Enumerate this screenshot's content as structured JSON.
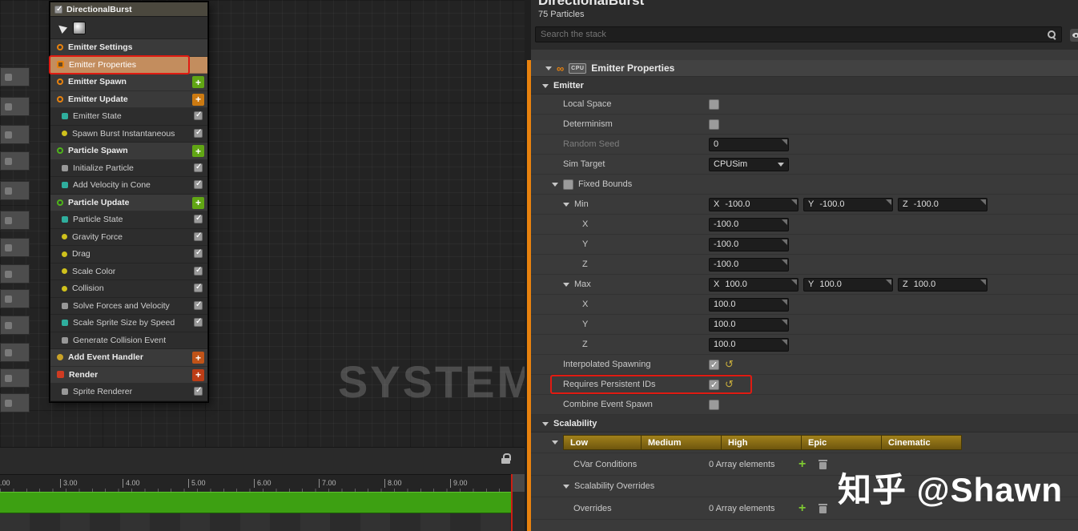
{
  "colors": {
    "accent_orange": "#E8820E",
    "annotation_red": "#E01B12",
    "selection_tan": "#C38D5E",
    "timeline_green": "#3DA012",
    "scalability_gold": "#8A6C10"
  },
  "watermarks": {
    "system": "SYSTEM",
    "zhihu": "知乎 @Shawn"
  },
  "node": {
    "title": "DirectionalBurst",
    "rows": [
      {
        "label": "Emitter Settings"
      },
      {
        "label": "Emitter Properties"
      },
      {
        "label": "Emitter Spawn"
      },
      {
        "label": "Emitter Update"
      },
      {
        "label": "Emitter State"
      },
      {
        "label": "Spawn Burst Instantaneous"
      },
      {
        "label": "Particle Spawn"
      },
      {
        "label": "Initialize Particle"
      },
      {
        "label": "Add Velocity in Cone"
      },
      {
        "label": "Particle Update"
      },
      {
        "label": "Particle State"
      },
      {
        "label": "Gravity Force"
      },
      {
        "label": "Drag"
      },
      {
        "label": "Scale Color"
      },
      {
        "label": "Collision"
      },
      {
        "label": "Solve Forces and Velocity"
      },
      {
        "label": "Scale Sprite Size by Speed"
      },
      {
        "label": "Generate Collision Event"
      },
      {
        "label": "Add Event Handler"
      },
      {
        "label": "Render"
      },
      {
        "label": "Sprite Renderer"
      }
    ]
  },
  "timeline": {
    "ticks": [
      ".00",
      "3.00",
      "4.00",
      "5.00",
      "6.00",
      "7.00",
      "8.00",
      "9.00"
    ]
  },
  "details": {
    "title": "DirectionalBurst",
    "particles": "75 Particles",
    "search_placeholder": "Search the stack",
    "header": "Emitter Properties",
    "cpu_chip": "CPU",
    "emitter_section": "Emitter",
    "rows": {
      "local_space": "Local Space",
      "determinism": "Determinism",
      "random_seed": "Random Seed",
      "random_seed_value": "0",
      "sim_target": "Sim Target",
      "sim_target_value": "CPUSim",
      "fixed_bounds": "Fixed Bounds",
      "min": "Min",
      "max": "Max",
      "x": "X",
      "y": "Y",
      "z": "Z",
      "min_vec": {
        "x": "-100.0",
        "y": "-100.0",
        "z": "-100.0"
      },
      "max_vec": {
        "x": "100.0",
        "y": "100.0",
        "z": "100.0"
      },
      "interpolated_spawning": "Interpolated Spawning",
      "requires_persistent_ids": "Requires Persistent IDs",
      "combine_event_spawn": "Combine Event Spawn"
    },
    "scalability": {
      "header": "Scalability",
      "platforms": [
        "Low",
        "Medium",
        "High",
        "Epic",
        "Cinematic"
      ],
      "cvar_conditions": "CVar Conditions",
      "cvar_value": "0 Array elements",
      "overrides_section": "Scalability Overrides",
      "overrides": "Overrides",
      "overrides_value": "0 Array elements"
    }
  }
}
